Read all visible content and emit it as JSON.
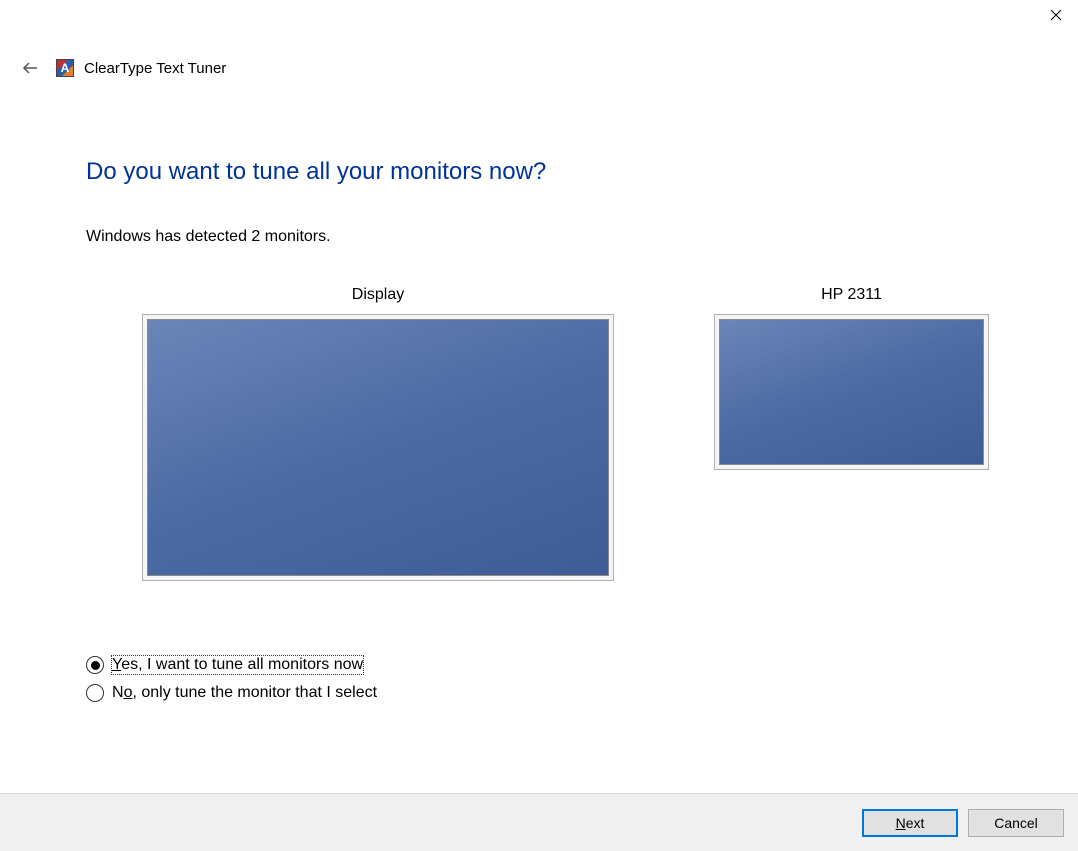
{
  "window": {
    "title": "ClearType Text Tuner"
  },
  "main": {
    "heading": "Do you want to tune all your monitors now?",
    "subtext": "Windows has detected 2 monitors."
  },
  "monitors": [
    {
      "label": "Display"
    },
    {
      "label": "HP 2311"
    }
  ],
  "options": {
    "yes_prefix": "Y",
    "yes_rest": "es, I want to tune all monitors now",
    "no_prefix": "N",
    "no_underline": "o",
    "no_rest": ", only tune the monitor that I select",
    "selected": "yes"
  },
  "footer": {
    "next_underline": "N",
    "next_rest": "ext",
    "cancel": "Cancel"
  }
}
